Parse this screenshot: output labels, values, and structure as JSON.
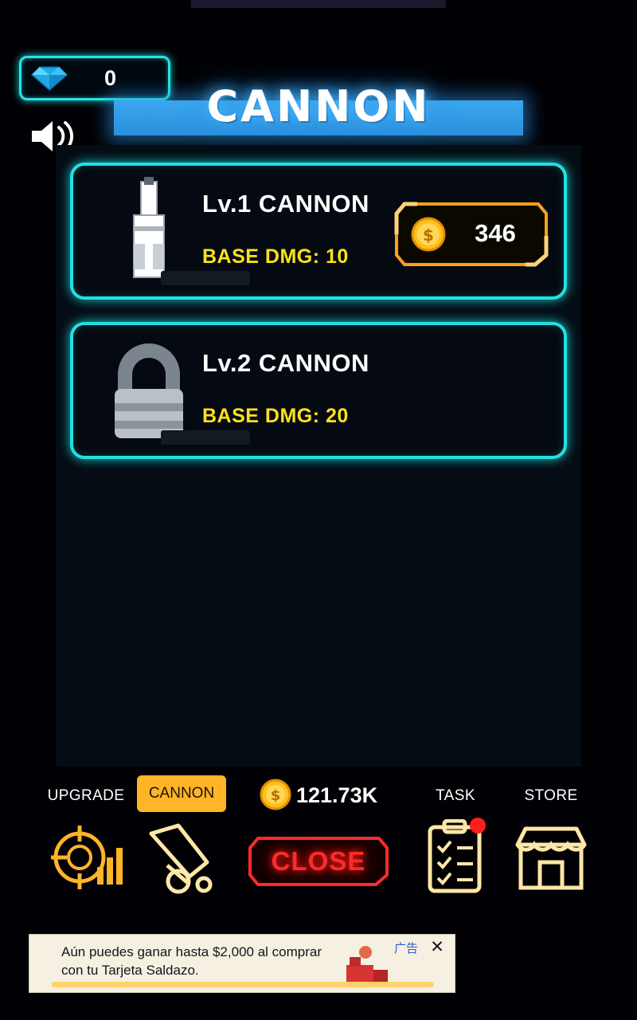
{
  "header": {
    "title": "CANNON",
    "gem_count": "0",
    "gem_icon": "diamond-icon",
    "sound_icon": "speaker-on-icon"
  },
  "shop": {
    "items": [
      {
        "name": "Lv.1 CANNON",
        "damage_label": "BASE DMG: 10",
        "price": "346",
        "coin_icon": "gold-coin-icon",
        "locked": false,
        "icon": "cannon-turret-icon"
      },
      {
        "name": "Lv.2 CANNON",
        "damage_label": "BASE DMG: 20",
        "price": "",
        "coin_icon": "",
        "locked": true,
        "icon": "padlock-icon"
      }
    ]
  },
  "bottom_nav": {
    "upgrade_label": "UPGRADE",
    "cannon_label": "CANNON",
    "coin_total": "121.73K",
    "task_label": "TASK",
    "store_label": "STORE",
    "close_label": "CLOSE",
    "icons": {
      "upgrade": "upgrade-target-icon",
      "cannon": "cannon-icon",
      "task": "clipboard-checklist-icon",
      "store": "storefront-icon"
    }
  },
  "ad": {
    "line1": "Aún puedes ganar hasta $2,000 al comprar",
    "line2": "con tu Tarjeta Saldazo.",
    "tag": "广告",
    "close": "✕"
  },
  "colors": {
    "neon_cyan": "#23e0e0",
    "gold": "#ffb526",
    "yellow": "#ffe11a",
    "red": "#ff2a2a",
    "blue": "#3ba7ef"
  }
}
